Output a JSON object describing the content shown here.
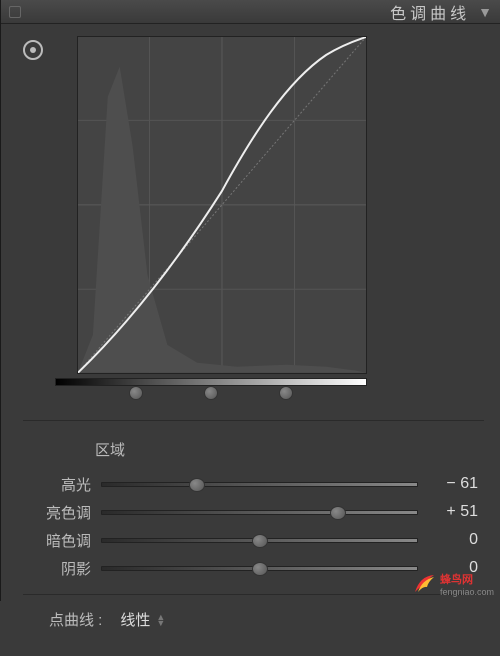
{
  "header": {
    "title": "色调曲线"
  },
  "region": {
    "label": "区域"
  },
  "sliders": [
    {
      "label": "高光",
      "value": "− 61",
      "pos": 30
    },
    {
      "label": "亮色调",
      "value": "+ 51",
      "pos": 75
    },
    {
      "label": "暗色调",
      "value": "0",
      "pos": 50
    },
    {
      "label": "阴影",
      "value": "0",
      "pos": 50
    }
  ],
  "pointCurve": {
    "label": "点曲线 :",
    "value": "线性"
  },
  "watermark": {
    "name": "蜂鸟网",
    "url": "fengniao.com"
  },
  "chart_data": {
    "type": "line",
    "title": "色调曲线",
    "xlabel": "",
    "ylabel": "",
    "xlim": [
      0,
      255
    ],
    "ylim": [
      0,
      255
    ],
    "series": [
      {
        "name": "curve",
        "x": [
          0,
          64,
          128,
          170,
          200,
          230,
          255
        ],
        "y": [
          0,
          50,
          138,
          192,
          222,
          244,
          255
        ]
      },
      {
        "name": "baseline",
        "x": [
          0,
          255
        ],
        "y": [
          0,
          255
        ]
      }
    ],
    "splits": [
      26,
      50,
      74
    ]
  }
}
